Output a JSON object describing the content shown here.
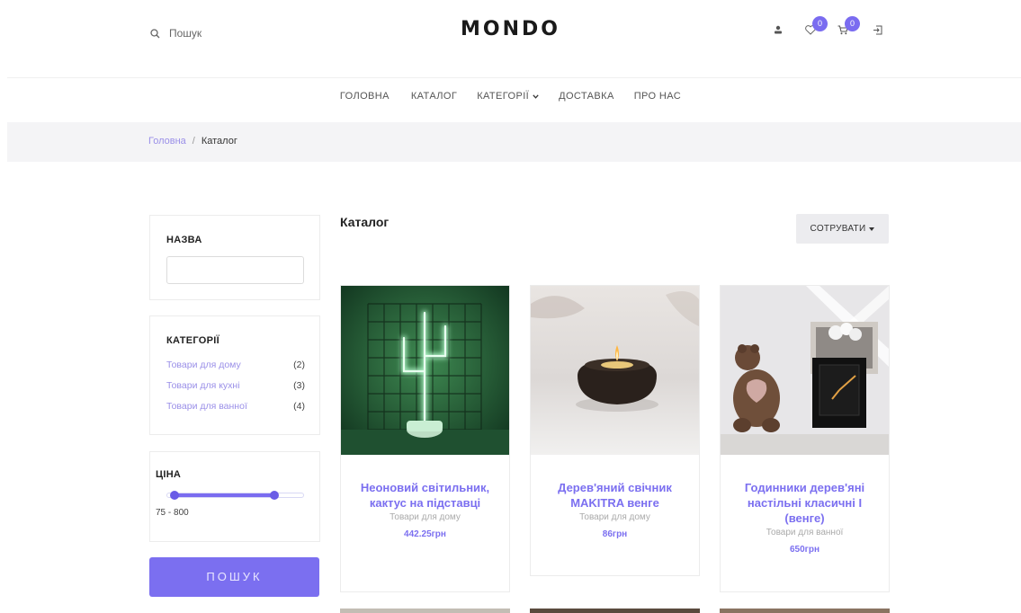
{
  "header": {
    "search_label": "Пошук",
    "logo": "MONDO",
    "wishlist_count": "0",
    "cart_count": "0"
  },
  "nav": {
    "items": [
      "ГОЛОВНА",
      "КАТАЛОГ",
      "КАТЕГОРІЇ",
      "ДОСТАВКА",
      "ПРО НАС"
    ]
  },
  "breadcrumb": {
    "home": "Головна",
    "separator": "/",
    "current": "Каталог"
  },
  "sidebar": {
    "name_filter": {
      "title": "НАЗВА",
      "value": ""
    },
    "categories": {
      "title": "КАТЕГОРІЇ",
      "items": [
        {
          "label": "Товари для дому",
          "count": "(2)"
        },
        {
          "label": "Товари для кухні",
          "count": "(3)"
        },
        {
          "label": "Товари для ванної",
          "count": "(4)"
        }
      ]
    },
    "price": {
      "title": "ЦІНА",
      "range_text": "75 - 800",
      "min": 75,
      "max": 800
    },
    "search_button": "ПОШУК"
  },
  "catalog": {
    "title": "Каталог",
    "sort_label": "СОТРУВАТИ",
    "products": [
      {
        "name": "Неоновий світильник, кактус на підставці",
        "category": "Товари для дому",
        "price": "442.25грн"
      },
      {
        "name": "Дерев'яний свічник MAKITRA венге",
        "category": "Товари для дому",
        "price": "86грн"
      },
      {
        "name": "Годинники дерев'яні настільні класичні I (венге)",
        "category": "Товари для ванної",
        "price": "650грн"
      }
    ]
  },
  "colors": {
    "accent": "#7b6ff0",
    "breadcrumb_bg": "#f4f4f6",
    "link": "#9a8fe8"
  }
}
